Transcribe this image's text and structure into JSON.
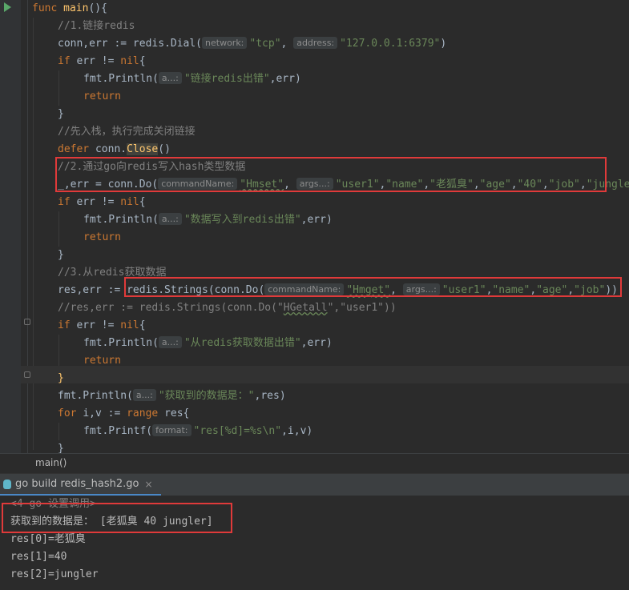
{
  "editor": {
    "lines": [
      [
        {
          "t": "func ",
          "c": "k"
        },
        {
          "t": "main",
          "c": "f"
        },
        {
          "t": "(){",
          "c": "p"
        }
      ],
      [
        {
          "t": "//1.链接redis",
          "c": "c"
        }
      ],
      [
        {
          "t": "conn,err := redis.Dial(",
          "c": "p"
        },
        {
          "hint": "network:"
        },
        {
          "t": "\"tcp\"",
          "c": "s"
        },
        {
          "t": ", ",
          "c": "p"
        },
        {
          "hint": "address:"
        },
        {
          "t": "\"127.0.0.1:6379\"",
          "c": "s"
        },
        {
          "t": ")",
          "c": "p"
        }
      ],
      [
        {
          "t": "if ",
          "c": "k"
        },
        {
          "t": "err != ",
          "c": "p"
        },
        {
          "t": "nil",
          "c": "k"
        },
        {
          "t": "{",
          "c": "p"
        }
      ],
      [
        {
          "t": "fmt.Println(",
          "c": "p"
        },
        {
          "hint": "a...:"
        },
        {
          "t": "\"链接redis出错\"",
          "c": "s"
        },
        {
          "t": ",err)",
          "c": "p"
        }
      ],
      [
        {
          "t": "return",
          "c": "k"
        }
      ],
      [
        {
          "t": "}",
          "c": "p"
        }
      ],
      [
        {
          "t": "//先入栈，执行完成关闭链接",
          "c": "c"
        }
      ],
      [
        {
          "t": "defer ",
          "c": "k"
        },
        {
          "t": "conn.",
          "c": "p"
        },
        {
          "t": "Close",
          "c": "f",
          "cls": "hl-close"
        },
        {
          "t": "()",
          "c": "p"
        }
      ],
      [
        {
          "t": "//2.通过go向redis写入hash类型数据",
          "c": "c"
        }
      ],
      [
        {
          "t": "_,err = conn.Do(",
          "c": "p"
        },
        {
          "hint": "commandName:"
        },
        {
          "t": "\"Hmset\"",
          "c": "s",
          "cls": "squiggle"
        },
        {
          "t": ", ",
          "c": "p"
        },
        {
          "hint": "args...:"
        },
        {
          "t": "\"user1\"",
          "c": "s"
        },
        {
          "t": ",",
          "c": "p"
        },
        {
          "t": "\"name\"",
          "c": "s"
        },
        {
          "t": ",",
          "c": "p"
        },
        {
          "t": "\"老狐臭\"",
          "c": "s"
        },
        {
          "t": ",",
          "c": "p"
        },
        {
          "t": "\"age\"",
          "c": "s"
        },
        {
          "t": ",",
          "c": "p"
        },
        {
          "t": "\"40\"",
          "c": "s"
        },
        {
          "t": ",",
          "c": "p"
        },
        {
          "t": "\"job\"",
          "c": "s"
        },
        {
          "t": ",",
          "c": "p"
        },
        {
          "t": "\"jungler\"",
          "c": "s"
        }
      ],
      [
        {
          "t": "if ",
          "c": "k"
        },
        {
          "t": "err != ",
          "c": "p"
        },
        {
          "t": "nil",
          "c": "k"
        },
        {
          "t": "{",
          "c": "p"
        }
      ],
      [
        {
          "t": "fmt.Println(",
          "c": "p"
        },
        {
          "hint": "a...:"
        },
        {
          "t": "\"数据写入到redis出错\"",
          "c": "s"
        },
        {
          "t": ",err)",
          "c": "p"
        }
      ],
      [
        {
          "t": "return",
          "c": "k"
        }
      ],
      [
        {
          "t": "}",
          "c": "p"
        }
      ],
      [
        {
          "t": "//3.从redis获取数据",
          "c": "c"
        }
      ],
      [
        {
          "t": "res,err := ",
          "c": "p"
        },
        {
          "t": "redis.Strings(conn.Do(",
          "c": "p"
        },
        {
          "hint": "commandName:"
        },
        {
          "t": "\"Hmget\"",
          "c": "s",
          "cls": "squiggle"
        },
        {
          "t": ", ",
          "c": "p"
        },
        {
          "hint": "args...:"
        },
        {
          "t": "\"user1\"",
          "c": "s"
        },
        {
          "t": ",",
          "c": "p"
        },
        {
          "t": "\"name\"",
          "c": "s"
        },
        {
          "t": ",",
          "c": "p"
        },
        {
          "t": "\"age\"",
          "c": "s"
        },
        {
          "t": ",",
          "c": "p"
        },
        {
          "t": "\"job\"",
          "c": "s"
        },
        {
          "t": "))",
          "c": "p"
        }
      ],
      [
        {
          "t": "//res,err := redis.Strings(conn.Do(\"",
          "c": "c"
        },
        {
          "t": "HGetall",
          "c": "c",
          "cls": "squiggle"
        },
        {
          "t": "\",\"user1\"))",
          "c": "c"
        }
      ],
      [
        {
          "t": "if ",
          "c": "k"
        },
        {
          "t": "err != ",
          "c": "p"
        },
        {
          "t": "nil",
          "c": "k"
        },
        {
          "t": "{",
          "c": "p"
        }
      ],
      [
        {
          "t": "fmt.Println(",
          "c": "p"
        },
        {
          "hint": "a...:"
        },
        {
          "t": "\"从redis获取数据出错\"",
          "c": "s"
        },
        {
          "t": ",err)",
          "c": "p"
        }
      ],
      [
        {
          "t": "return",
          "c": "k"
        }
      ],
      [
        {
          "t": "}",
          "c": "f"
        }
      ],
      [
        {
          "t": "fmt.Println(",
          "c": "p"
        },
        {
          "hint": "a...:"
        },
        {
          "t": "\"获取到的数据是：\"",
          "c": "s"
        },
        {
          "t": ",res)",
          "c": "p"
        }
      ],
      [
        {
          "t": "for ",
          "c": "k"
        },
        {
          "t": "i,v := ",
          "c": "p"
        },
        {
          "t": "range ",
          "c": "k"
        },
        {
          "t": "res{",
          "c": "p"
        }
      ],
      [
        {
          "t": "fmt.Printf(",
          "c": "p"
        },
        {
          "hint": "format:"
        },
        {
          "t": "\"res[%d]=%s\\n\"",
          "c": "s"
        },
        {
          "t": ",i,v)",
          "c": "p"
        }
      ],
      [
        {
          "t": "}",
          "c": "p"
        }
      ]
    ]
  },
  "breadcrumb": {
    "label": "main()"
  },
  "run_tab": {
    "label": "go build redis_hash2.go",
    "close": "×"
  },
  "console": {
    "lines": [
      {
        "text": "<4 go 设置调用>",
        "dim": true
      },
      {
        "text": "获取到的数据是： [老狐臭 40 jungler]"
      },
      {
        "text": "res[0]=老狐臭"
      },
      {
        "text": "res[1]=40"
      },
      {
        "text": "res[2]=jungler"
      }
    ]
  },
  "colors": {
    "keyword": "#cc7832",
    "string": "#6a8759",
    "comment": "#808080",
    "func": "#ffc66d",
    "highlight": "#e03a3a"
  }
}
